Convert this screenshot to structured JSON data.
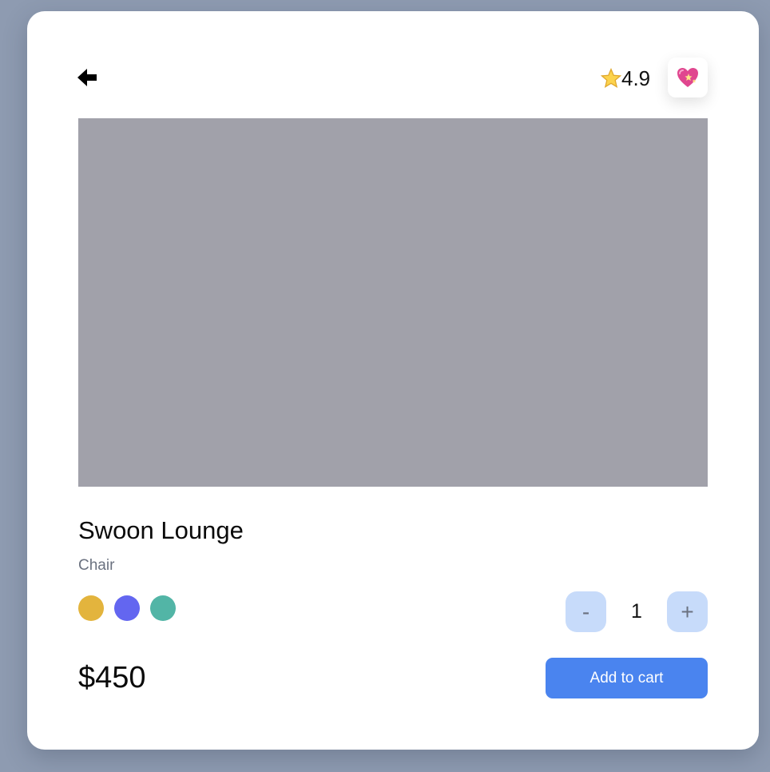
{
  "header": {
    "back_icon": "arrow-left-icon",
    "rating": "4.9",
    "rating_icon": "star-icon",
    "favorite_icon": "sparkling-heart-icon"
  },
  "product": {
    "name": "Swoon Lounge",
    "category": "Chair",
    "price": "$450",
    "image_color": "#a1a1aa",
    "colors": [
      "#e3b43d",
      "#6366f0",
      "#52b5a6"
    ]
  },
  "quantity": {
    "decrement_label": "-",
    "value": "1",
    "increment_label": "+"
  },
  "actions": {
    "add_to_cart_label": "Add to cart"
  },
  "theme": {
    "accent": "#4a84ef",
    "qty_button_bg": "#c7dbfa"
  }
}
